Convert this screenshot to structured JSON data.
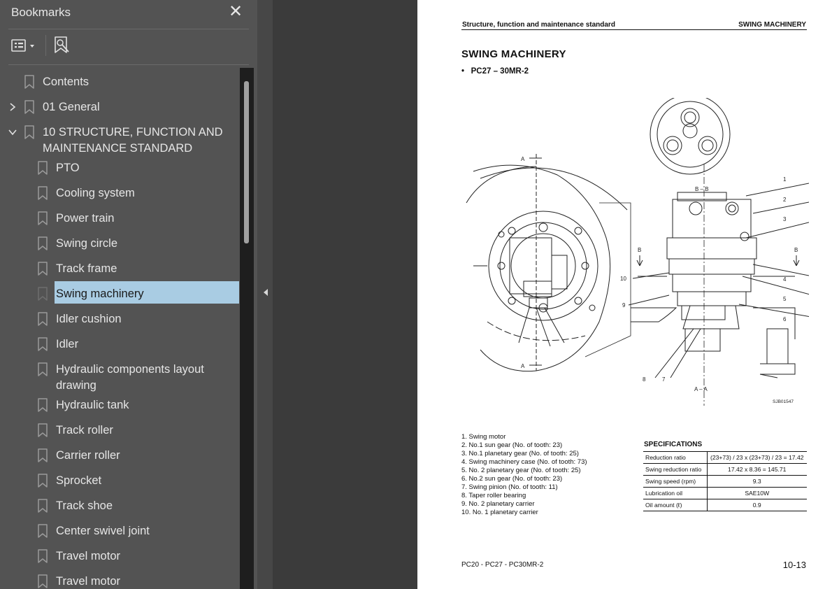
{
  "panel": {
    "title": "Bookmarks",
    "close_label": "✕"
  },
  "bookmarks": [
    {
      "label": "Contents"
    },
    {
      "label": "01 General"
    },
    {
      "label": "10 STRUCTURE, FUNCTION AND MAINTENANCE STANDARD"
    },
    {
      "label": "PTO"
    },
    {
      "label": "Cooling system"
    },
    {
      "label": "Power train"
    },
    {
      "label": "Swing circle"
    },
    {
      "label": "Track frame"
    },
    {
      "label": "Swing machinery"
    },
    {
      "label": "Idler cushion"
    },
    {
      "label": "Idler"
    },
    {
      "label": "Hydraulic components layout drawing"
    },
    {
      "label": "Hydraulic tank"
    },
    {
      "label": "Track roller"
    },
    {
      "label": "Carrier roller"
    },
    {
      "label": "Sprocket"
    },
    {
      "label": "Track shoe"
    },
    {
      "label": "Center swivel joint"
    },
    {
      "label": "Travel motor"
    },
    {
      "label": "Travel motor"
    }
  ],
  "document": {
    "header_left": "Structure, function and maintenance standard",
    "header_right": "SWING MACHINERY",
    "title": "SWING MACHINERY",
    "subtitle": "PC27 – 30MR-2",
    "drawing_labels": {
      "section_bb": "B – B",
      "section_aa": "A – A",
      "marker_a": "A",
      "marker_b": "B",
      "figure_code": "SJB01547",
      "callouts": [
        "1",
        "2",
        "3",
        "4",
        "5",
        "6",
        "7",
        "8",
        "9",
        "10"
      ]
    },
    "parts": [
      "1. Swing motor",
      "2. No.1 sun gear (No. of tooth: 23)",
      "3. No.1 planetary gear (No. of tooth: 25)",
      "4. Swing machinery case (No. of tooth: 73)",
      "5. No. 2 planetary gear (No. of tooth: 25)",
      "6. No.2 sun gear (No. of tooth: 23)",
      "7. Swing pinion (No. of tooth: 11)",
      "8. Taper roller bearing",
      "9. No. 2 planetary carrier",
      "10. No. 1 planetary carrier"
    ],
    "spec_title": "SPECIFICATIONS",
    "specs": [
      {
        "key": "Reduction ratio",
        "value": "(23+73) / 23 x (23+73) / 23 = 17.42"
      },
      {
        "key": "Swing reduction ratio",
        "value": "17.42 x 8.36 = 145.71"
      },
      {
        "key": "Swing speed (rpm)",
        "value": "9.3"
      },
      {
        "key": "Lubrication oil",
        "value": "SAE10W"
      },
      {
        "key": "Oil amount (ℓ)",
        "value": "0.9"
      }
    ],
    "footer_left": "PC20 - PC27 - PC30MR-2",
    "footer_right": "10-13"
  }
}
